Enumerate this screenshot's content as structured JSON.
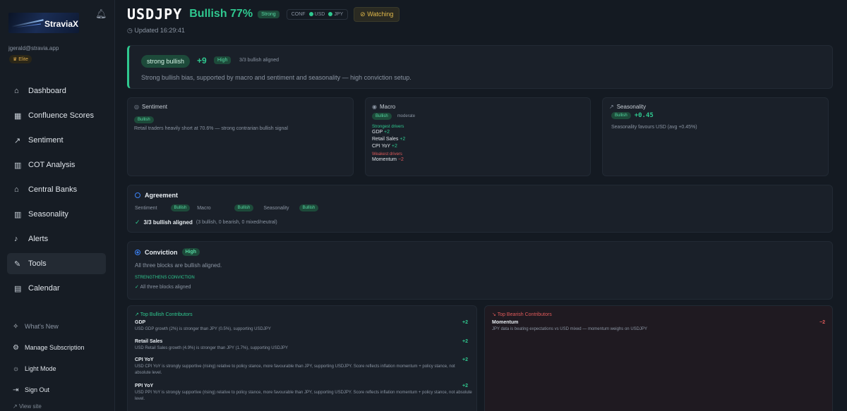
{
  "app": {
    "name": "StraviaX",
    "user_email": "jgerald@stravia.app",
    "tier": "Elite"
  },
  "nav": [
    {
      "label": "Dashboard",
      "icon": "dashboard-icon"
    },
    {
      "label": "Confluence Scores",
      "icon": "grid-icon"
    },
    {
      "label": "Sentiment",
      "icon": "trend-icon"
    },
    {
      "label": "COT Analysis",
      "icon": "bar-chart-icon"
    },
    {
      "label": "Central Banks",
      "icon": "bank-icon"
    },
    {
      "label": "Seasonality",
      "icon": "bar-chart-icon"
    },
    {
      "label": "Alerts",
      "icon": "bell-icon"
    },
    {
      "label": "Tools",
      "icon": "wrench-icon"
    },
    {
      "label": "Calendar",
      "icon": "calendar-icon"
    }
  ],
  "bottom_nav": {
    "whats_new": "What's New",
    "manage_subscription": "Manage Subscription",
    "light_mode": "Light Mode",
    "sign_out": "Sign Out",
    "view_site": "View site"
  },
  "header": {
    "pair": "USDJPY",
    "bias": "Bullish 77%",
    "strength": "Strong",
    "conf_label": "CONF",
    "conf_ccy1": "USD",
    "conf_ccy2": "JPY",
    "watching": "Watching",
    "updated": "Updated 16:29:41"
  },
  "summary": {
    "label": "strong bullish",
    "score": "+9",
    "conviction": "High",
    "aligned": "3/3 bullish aligned",
    "text": "Strong bullish bias, supported by macro and sentiment and seasonality — high conviction setup."
  },
  "sentiment": {
    "title": "Sentiment",
    "pill": "Bullish",
    "text": "Retail traders heavily short at 70.6% — strong contrarian bullish signal"
  },
  "macro": {
    "title": "Macro",
    "pill": "Bullish",
    "strength": "moderate",
    "strongest_label": "Strongest drivers",
    "strongest": [
      {
        "name": "GDP",
        "score": "+2"
      },
      {
        "name": "Retail Sales",
        "score": "+2"
      },
      {
        "name": "CPI YoY",
        "score": "+2"
      }
    ],
    "weakest_label": "Weakest drivers",
    "weakest": [
      {
        "name": "Momentum",
        "score": "−2"
      }
    ]
  },
  "seasonality": {
    "title": "Seasonality",
    "pill": "Bullish",
    "score": "+0.45",
    "text": "Seasonality favours USD (avg +0.45%)"
  },
  "agreement": {
    "title": "Agreement",
    "items": [
      {
        "label": "Sentiment",
        "pill": "Bullish"
      },
      {
        "label": "Macro",
        "pill": "Bullish"
      },
      {
        "label": "Seasonality",
        "pill": "Bullish"
      }
    ],
    "result": "3/3 bullish aligned",
    "detail": "(3 bullish, 0 bearish, 0 mixed/neutral)"
  },
  "conviction": {
    "title": "Conviction",
    "level": "High",
    "text": "All three blocks are bullish aligned.",
    "strengthens_label": "STRENGTHENS CONVICTION",
    "strengthens_item": "All three blocks aligned"
  },
  "bullish_contributors": {
    "title": "Top Bullish Contributors",
    "items": [
      {
        "name": "GDP",
        "score": "+2",
        "desc": "USD GDP growth (2%) is stronger than JPY (0.5%), supporting USDJPY"
      },
      {
        "name": "Retail Sales",
        "score": "+2",
        "desc": "USD Retail Sales growth (4.9%) is stronger than JPY (1.7%), supporting USDJPY"
      },
      {
        "name": "CPI YoY",
        "score": "+2",
        "desc": "USD CPI YoY is strongly supportive (rising) relative to policy stance, more favourable than JPY, supporting USDJPY. Score reflects inflation momentum + policy stance, not absolute level."
      },
      {
        "name": "PPI YoY",
        "score": "+2",
        "desc": "USD PPI YoY is strongly supportive (rising) relative to policy stance, more favourable than JPY, supporting USDJPY. Score reflects inflation momentum + policy stance, not absolute level."
      }
    ]
  },
  "bearish_contributors": {
    "title": "Top Bearish Contributors",
    "items": [
      {
        "name": "Momentum",
        "score": "−2",
        "desc": "JPY data is beating expectations vs USD mixed — momentum weighs on USDJPY"
      }
    ]
  },
  "colors": {
    "accent": "#2fc88f",
    "negative": "#e05a5a",
    "warning": "#e0b84a",
    "info": "#3b82f6"
  }
}
